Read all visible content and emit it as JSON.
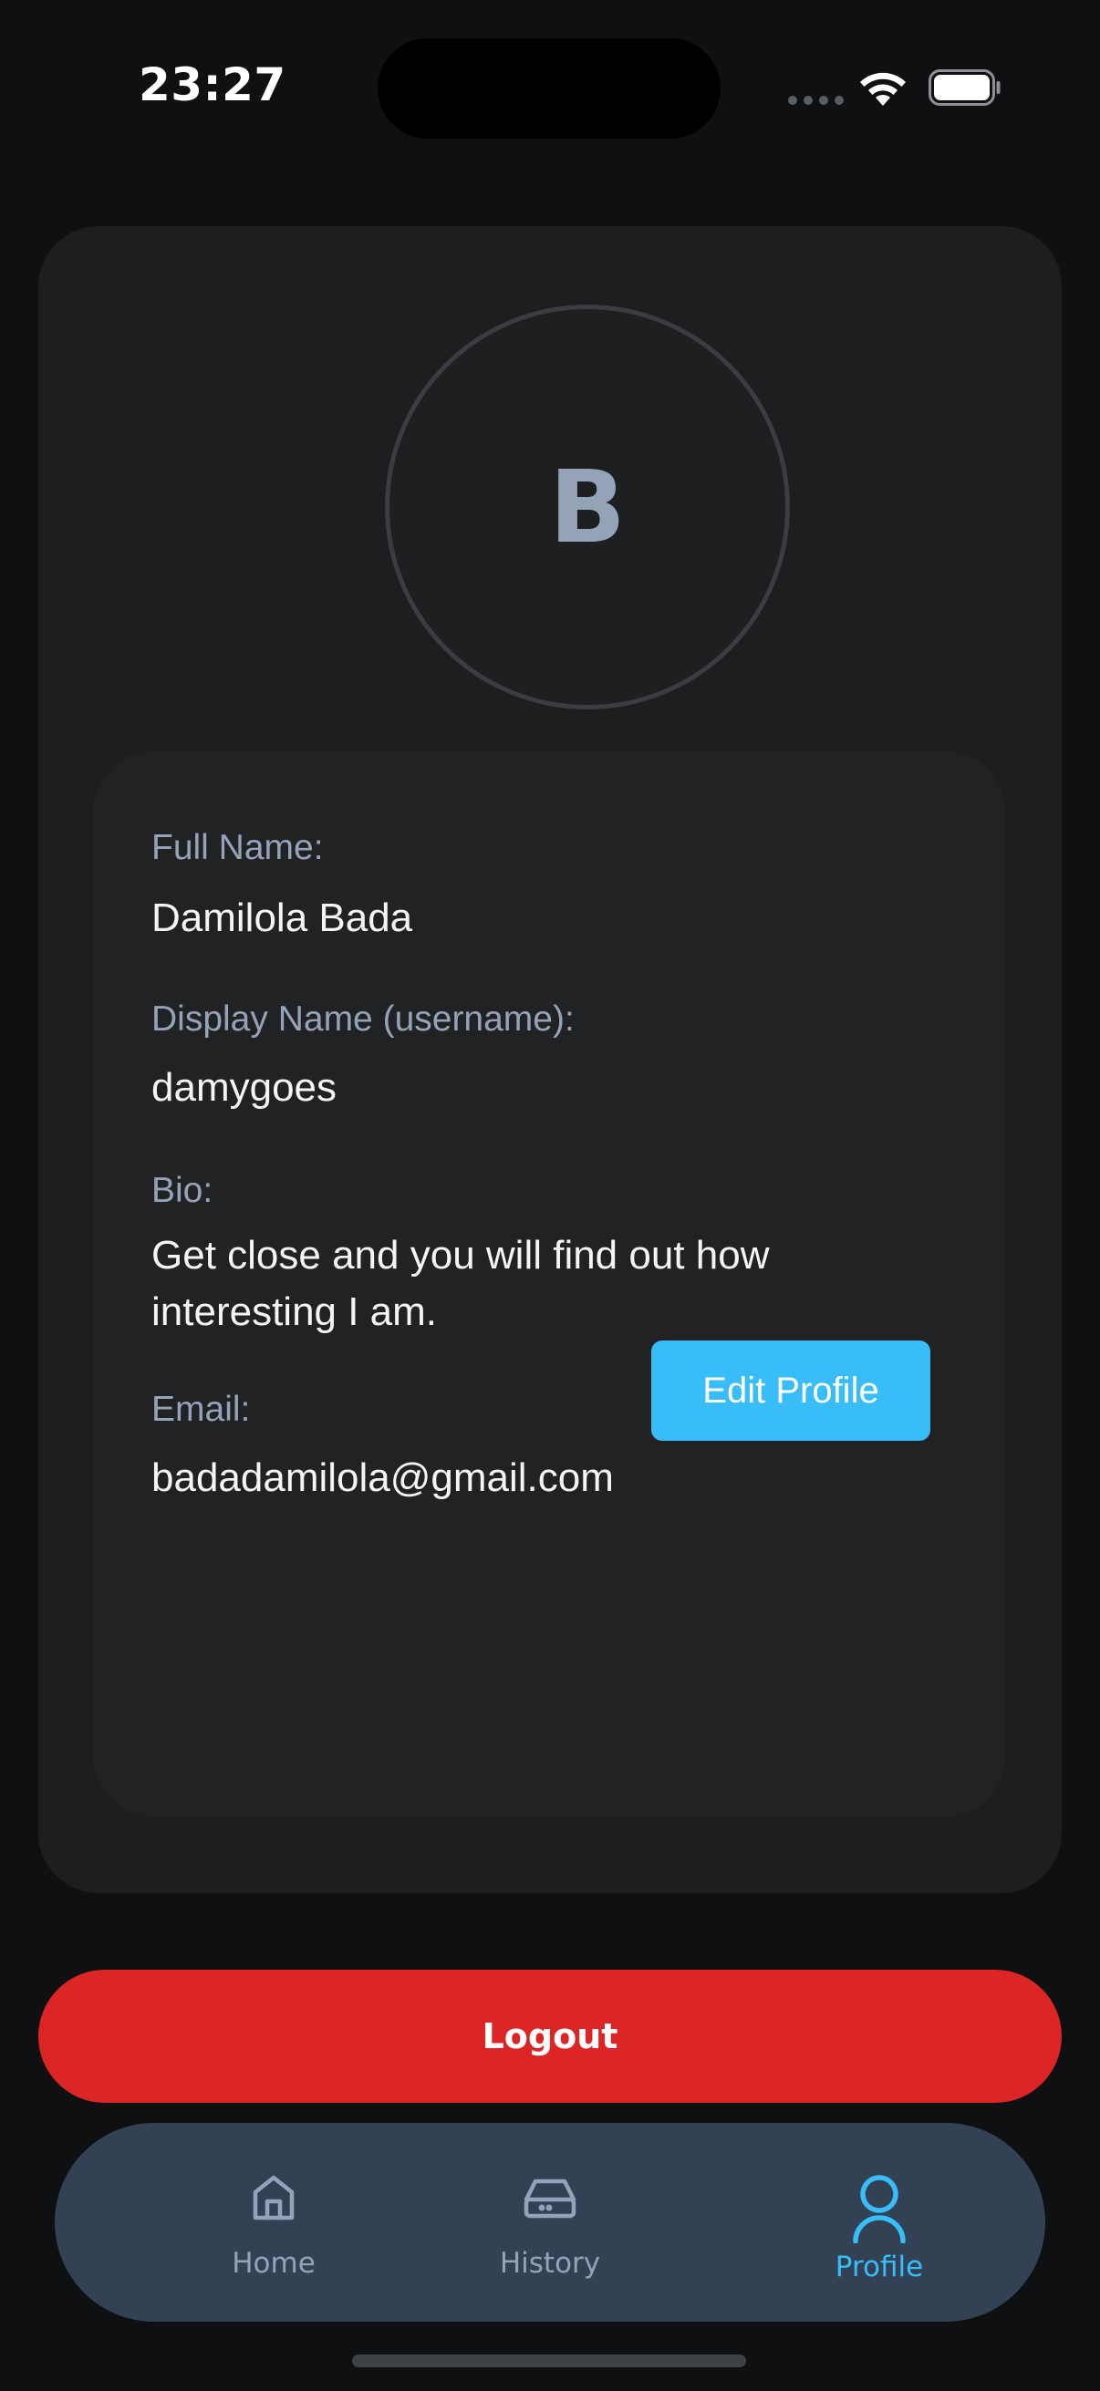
{
  "status_bar": {
    "time": "23:27"
  },
  "profile": {
    "avatar_initial": "B",
    "fields": [
      {
        "label": "Full Name:",
        "value": "Damilola Bada"
      },
      {
        "label": "Display Name (username):",
        "value": "damygoes"
      },
      {
        "label": "Bio:",
        "value": "Get close and you will find out how interesting I am."
      },
      {
        "label": "Email:",
        "value": "badadamilola@gmail.com"
      }
    ],
    "edit_label": "Edit Profile"
  },
  "logout_label": "Logout",
  "tab_bar": {
    "active": "Profile",
    "items": [
      {
        "label": "Home",
        "icon": "home-icon"
      },
      {
        "label": "History",
        "icon": "inbox-tray-icon"
      },
      {
        "label": "Profile",
        "icon": "user-icon"
      }
    ]
  },
  "colors": {
    "background": "#0e1012",
    "card": "#1c1e1f",
    "accent": "#38bdf8",
    "danger": "#dc2626",
    "tab_bar": "#334155",
    "muted_text": "#94a3b8"
  }
}
